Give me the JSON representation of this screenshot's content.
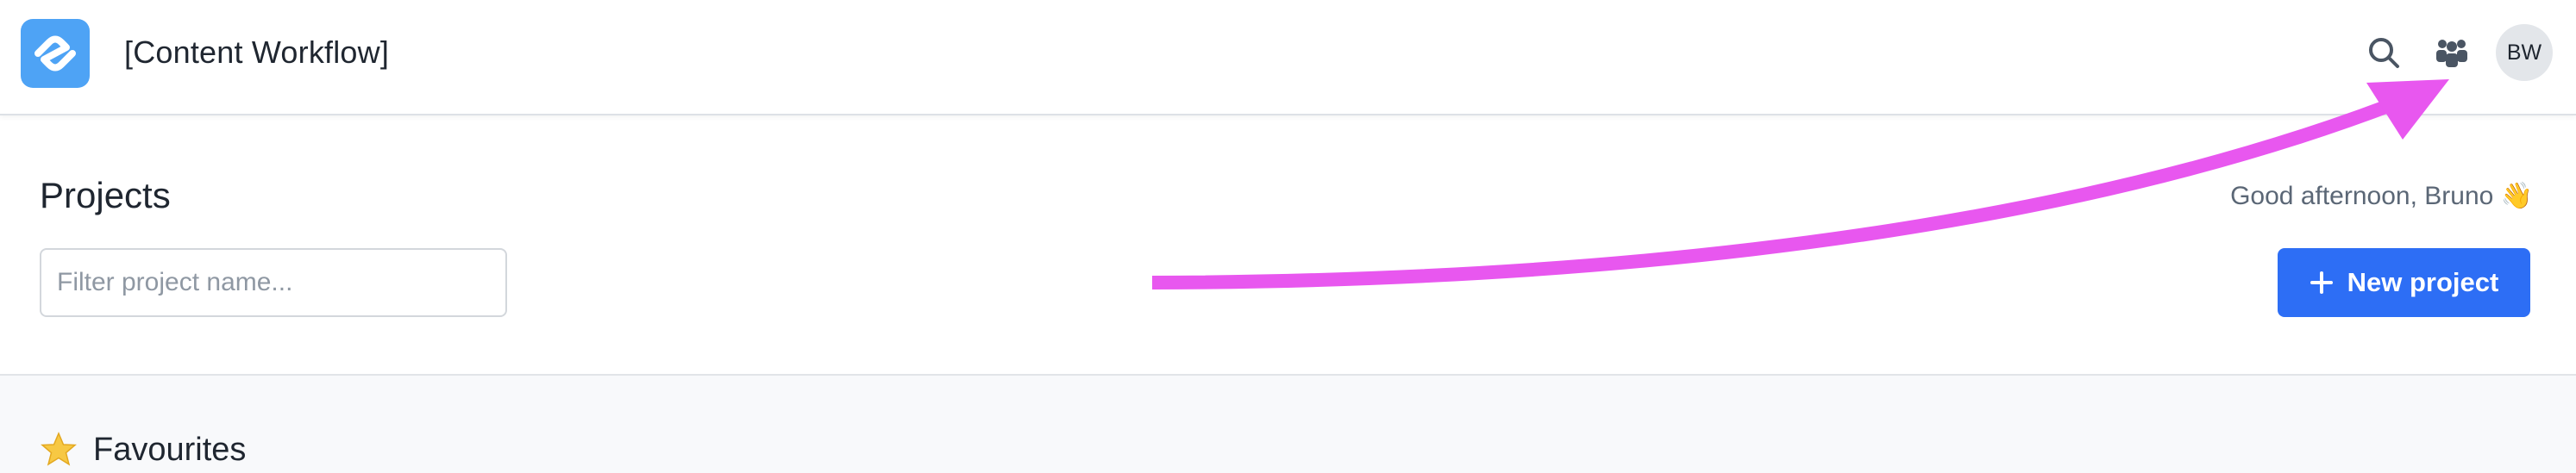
{
  "header": {
    "app_title": "[Content Workflow]",
    "logo_icon": "app-logo-icon",
    "brand_color": "#4ea3f5",
    "search_icon": "search-icon",
    "team_icon": "team-icon",
    "avatar_initials": "BW"
  },
  "main": {
    "title": "Projects",
    "greeting": "Good afternoon, Bruno 👋",
    "filter": {
      "placeholder": "Filter project name...",
      "value": ""
    },
    "new_project_label": "New project",
    "accent_color": "#2d6ef5"
  },
  "favourites": {
    "title": "Favourites",
    "icon": "star-icon"
  },
  "annotation": {
    "arrow_color": "#e857ef"
  }
}
